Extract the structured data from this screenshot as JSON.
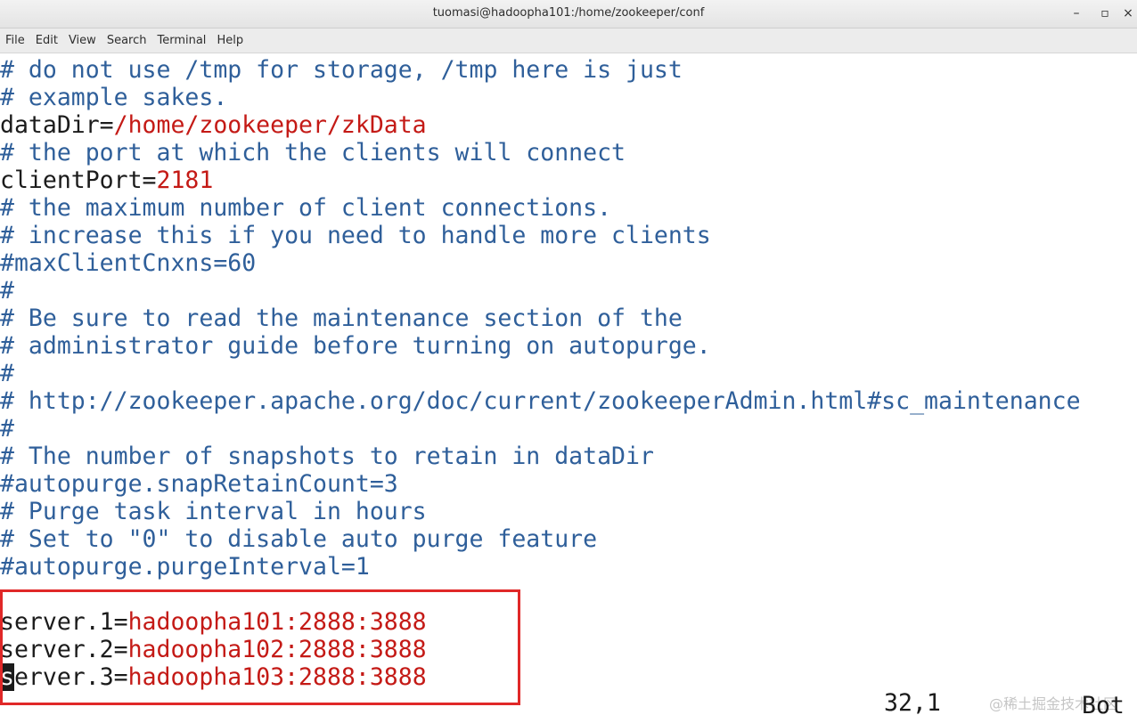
{
  "window": {
    "title": "tuomasi@hadoopha101:/home/zookeeper/conf",
    "minimize_glyph": "–",
    "maximize_glyph": "▫",
    "close_glyph": "×"
  },
  "menu": {
    "items": [
      "File",
      "Edit",
      "View",
      "Search",
      "Terminal",
      "Help"
    ]
  },
  "editor": {
    "lines": [
      {
        "comment": "# do not use /tmp for storage, /tmp here is just"
      },
      {
        "comment": "# example sakes."
      },
      {
        "key": "dataDir=",
        "value": "/home/zookeeper/zkData"
      },
      {
        "comment": "# the port at which the clients will connect"
      },
      {
        "key": "clientPort=",
        "value": "2181"
      },
      {
        "comment": "# the maximum number of client connections."
      },
      {
        "comment": "# increase this if you need to handle more clients"
      },
      {
        "comment": "#maxClientCnxns=60"
      },
      {
        "comment": "#"
      },
      {
        "comment": "# Be sure to read the maintenance section of the"
      },
      {
        "comment": "# administrator guide before turning on autopurge."
      },
      {
        "comment": "#"
      },
      {
        "comment": "# http://zookeeper.apache.org/doc/current/zookeeperAdmin.html#sc_maintenance"
      },
      {
        "comment": "#"
      },
      {
        "comment": "# The number of snapshots to retain in dataDir"
      },
      {
        "comment": "#autopurge.snapRetainCount=3"
      },
      {
        "comment": "# Purge task interval in hours"
      },
      {
        "comment": "# Set to \"0\" to disable auto purge feature"
      },
      {
        "comment": "#autopurge.purgeInterval=1"
      },
      {
        "blank": ""
      },
      {
        "key": "server.1=",
        "value": "hadoopha101:2888:3888"
      },
      {
        "key": "server.2=",
        "value": "hadoopha102:2888:3888"
      },
      {
        "cursor_char": "s",
        "key": "erver.3=",
        "value": "hadoopha103:2888:3888"
      }
    ]
  },
  "status": {
    "position": "32,1",
    "scroll": "Bot"
  },
  "watermark": "@稀土掘金技术社区",
  "colors": {
    "comment": "#2f5f9a",
    "value": "#c41a16",
    "text": "#1b1b1b",
    "highlight_border": "#e02828"
  }
}
